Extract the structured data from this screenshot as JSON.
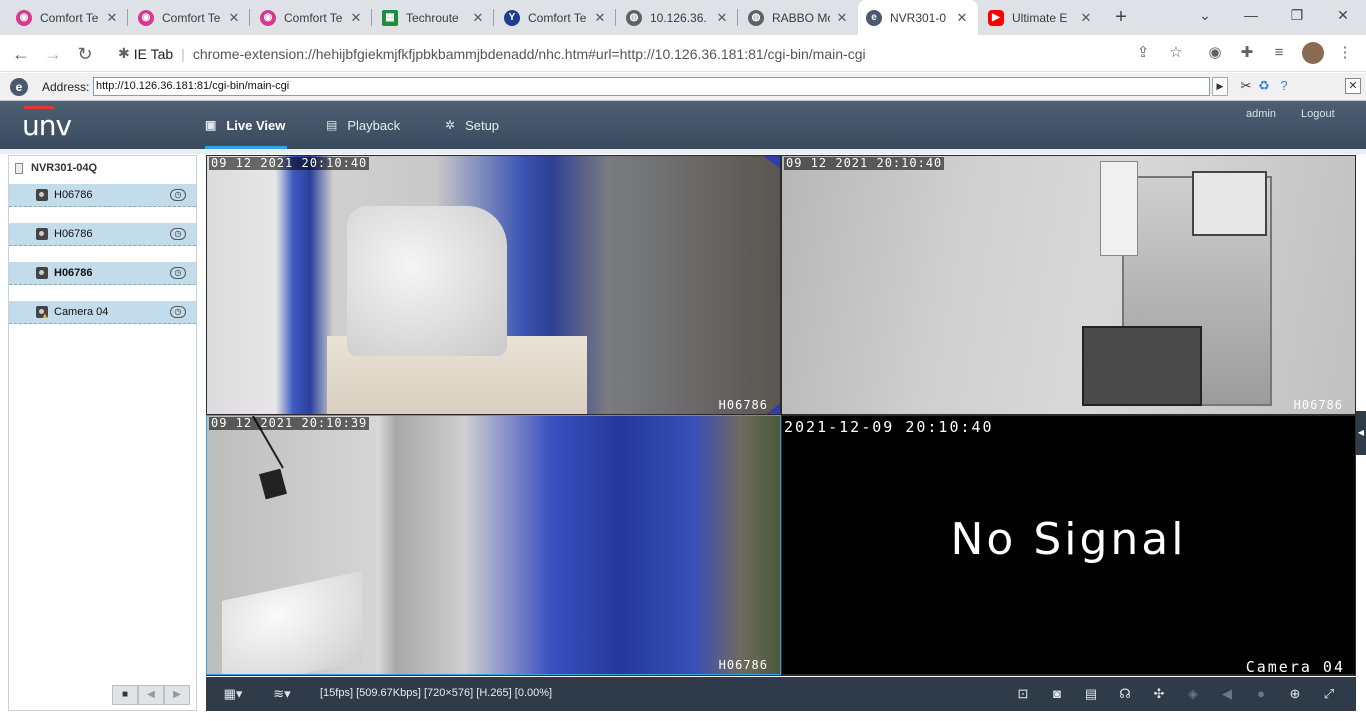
{
  "browser": {
    "tabs": [
      {
        "title": "Comfort Te",
        "icon": "uniview-icon",
        "color": "#d63a8f"
      },
      {
        "title": "Comfort Te",
        "icon": "uniview-icon",
        "color": "#d63a8f"
      },
      {
        "title": "Comfort Te",
        "icon": "uniview-icon",
        "color": "#d63a8f"
      },
      {
        "title": "Techroute",
        "icon": "sheets-icon",
        "color": "#1e8e3e"
      },
      {
        "title": "Comfort Te",
        "icon": "y-icon",
        "color": "#1a3e8c"
      },
      {
        "title": "10.126.36.",
        "icon": "globe-icon",
        "color": "#5f6368"
      },
      {
        "title": "RABBO Mo",
        "icon": "globe-icon",
        "color": "#5f6368"
      },
      {
        "title": "NVR301-0",
        "icon": "ie-icon",
        "color": "#4a5a6e"
      },
      {
        "title": "Ultimate E",
        "icon": "youtube-icon",
        "color": "#ff0000"
      }
    ],
    "ext_label": "IE Tab",
    "url": "chrome-extension://hehijbfgiekmjfkfjpbkbammjbdenadd/nhc.htm#url=http://10.126.36.181:81/cgi-bin/main-cgi"
  },
  "ietab": {
    "address_label": "Address:",
    "address_value": "http://10.126.36.181:81/cgi-bin/main-cgi"
  },
  "app": {
    "logo": "unv",
    "nav": [
      {
        "label": "Live View",
        "icon": "monitor-icon"
      },
      {
        "label": "Playback",
        "icon": "film-icon"
      },
      {
        "label": "Setup",
        "icon": "gear-icon"
      }
    ],
    "user": "admin",
    "logout": "Logout"
  },
  "sidebar": {
    "device": "NVR301-04Q",
    "cameras": [
      {
        "label": "H06786",
        "bold": false
      },
      {
        "label": "H06786",
        "bold": false
      },
      {
        "label": "H06786",
        "bold": true
      },
      {
        "label": "Camera 04",
        "bold": false,
        "warning": true
      }
    ]
  },
  "video": {
    "cells": [
      {
        "time": "09 12 2021  20:10:40",
        "name": "H06786"
      },
      {
        "time": "09 12 2021  20:10:40",
        "name": "H06786"
      },
      {
        "time": "09 12 2021  20:10:39",
        "name": "H06786"
      }
    ],
    "nosignal": {
      "time": "2021-12-09  20:10:40",
      "message": "No  Signal",
      "name": "Camera 04"
    }
  },
  "toolbar": {
    "status": "[15fps] [509.67Kbps] [720×576] [H.265] [0.00%]"
  }
}
